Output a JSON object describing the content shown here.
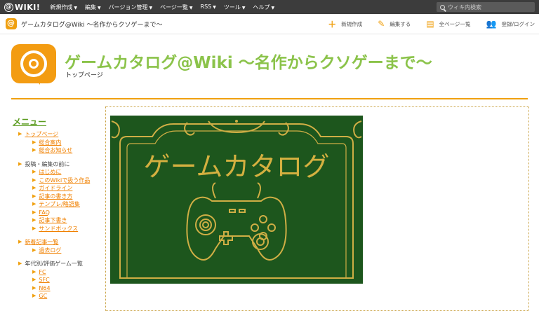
{
  "topbar": {
    "logo": "WIKI!",
    "nav": [
      "新規作成",
      "編集",
      "バージョン管理",
      "ページ一覧",
      "RSS",
      "ツール",
      "ヘルプ"
    ],
    "search_placeholder": "ウィキ内検索"
  },
  "subbar": {
    "title": "ゲームカタログ@Wiki ～名作からクソゲーまで～",
    "actions": [
      {
        "label": "新規作成",
        "icon": "plus-icon"
      },
      {
        "label": "編集する",
        "icon": "pencil-icon"
      },
      {
        "label": "全ページ一覧",
        "icon": "pages-icon"
      },
      {
        "label": "登録/ログイン",
        "icon": "user-add-icon"
      }
    ]
  },
  "header": {
    "title": "ゲームカタログ@Wiki ～名作からクソゲーまで～",
    "breadcrumb": "トップページ"
  },
  "sidebar": {
    "title": "メニュー",
    "groups": [
      {
        "label": "トップページ",
        "link": true,
        "items": [
          "総合案内",
          "総合お知らせ"
        ]
      },
      {
        "label": "投稿・編集の前に",
        "link": false,
        "items": [
          "はじめに",
          "このWikiで扱う作品",
          "ガイドライン",
          "記事の書き方",
          "テンプレ/略語集",
          "FAQ",
          "記事下書き",
          "サンドボックス"
        ]
      },
      {
        "label": "新着記事一覧",
        "link": true,
        "items": [
          "過去ログ"
        ]
      },
      {
        "label": "年代別/評価ゲーム一覧",
        "link": false,
        "items": [
          "FC",
          "SFC",
          "N64",
          "GC"
        ]
      }
    ]
  },
  "banner": {
    "text": "ゲームカタログ",
    "bg": "#1e5a1e",
    "accent": "#d4b040"
  },
  "colors": {
    "brand": "#f39c12",
    "title_green": "#8bc34a",
    "topbar": "#3c3c3c"
  }
}
